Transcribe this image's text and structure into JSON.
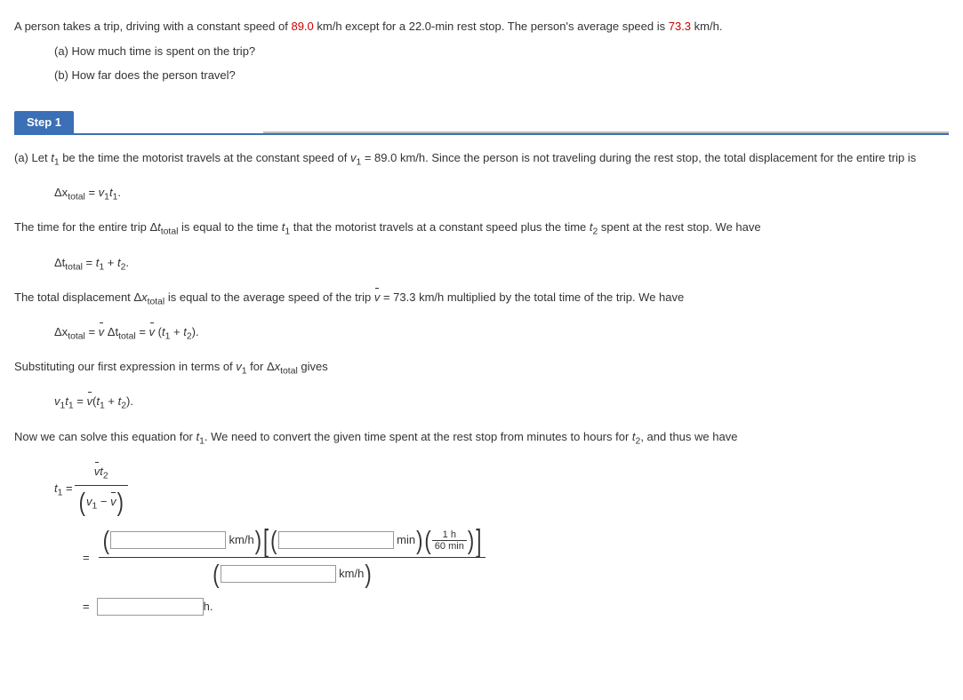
{
  "problem": {
    "intro_pre": "A person takes a trip, driving with a constant speed of ",
    "speed_const": "89.0",
    "intro_mid": " km/h except for a 22.0-min rest stop. The person's average speed is ",
    "speed_avg": "73.3",
    "intro_post": " km/h.",
    "qa": "(a) How much time is spent on the trip?",
    "qb": "(b) How far does the person travel?"
  },
  "step": {
    "label": "Step 1",
    "line_a_pre": "(a) Let ",
    "t1": "t",
    "t1_sub": "1",
    "line_a_mid": " be the time the motorist travels at the constant speed of ",
    "v1": "v",
    "v1_sub": "1",
    "line_a_val": " = 89.0 km/h. Since the person is not traveling during the rest stop, the total displacement for the entire trip is",
    "eq1_lhs": "Δx",
    "eq1_sub": "total",
    "eq1_eq": " = ",
    "eq1_rhs_v": "v",
    "eq1_rhs_vsub": "1",
    "eq1_rhs_t": "t",
    "eq1_rhs_tsub": "1",
    "eq1_end": ".",
    "line2_pre": "The time for the entire trip Δ",
    "line2_t": "t",
    "line2_tsub": "total",
    "line2_mid": " is equal to the time ",
    "line2_t1": "t",
    "line2_t1sub": "1",
    "line2_mid2": " that the motorist travels at a constant speed plus the time ",
    "line2_t2": "t",
    "line2_t2sub": "2",
    "line2_end": " spent at the rest stop. We have",
    "eq2_pre": "Δt",
    "eq2_sub": "total",
    "eq2_eq": " = ",
    "eq2_t1": "t",
    "eq2_t1sub": "1",
    "eq2_plus": " + ",
    "eq2_t2": "t",
    "eq2_t2sub": "2",
    "eq2_end": ".",
    "line3_pre": "The total displacement Δ",
    "line3_x": "x",
    "line3_xsub": "total",
    "line3_mid": " is equal to the average speed of the trip ",
    "line3_v": "v",
    "line3_val": " = 73.3 km/h multiplied by the total time of the trip. We have",
    "eq3_dx": "Δx",
    "eq3_dxsub": "total",
    "eq3_eq1": " = ",
    "eq3_v": "v",
    "eq3_dt": " Δt",
    "eq3_dtsub": "total",
    "eq3_eq2": " = ",
    "eq3_paren_open": " (",
    "eq3_t1": "t",
    "eq3_t1sub": "1",
    "eq3_plus": " + ",
    "eq3_t2": "t",
    "eq3_t2sub": "2",
    "eq3_paren_close": ").",
    "line4_pre": "Substituting our first expression in terms of ",
    "line4_v1": "v",
    "line4_v1sub": "1",
    "line4_mid": " for Δ",
    "line4_x": "x",
    "line4_xsub": "total",
    "line4_end": " gives",
    "eq4_v1": "v",
    "eq4_v1sub": "1",
    "eq4_t1": "t",
    "eq4_t1sub": "1",
    "eq4_eq": " = ",
    "eq4_v": "v",
    "eq4_popen": "(",
    "eq4_t1b": "t",
    "eq4_t1bsub": "1",
    "eq4_plus": " + ",
    "eq4_t2": "t",
    "eq4_t2sub": "2",
    "eq4_pclose": ").",
    "line5_pre": "Now we can solve this equation for ",
    "line5_t1": "t",
    "line5_t1sub": "1",
    "line5_mid": ". We need to convert the given time spent at the rest stop from minutes to hours for ",
    "line5_t2": "t",
    "line5_t2sub": "2",
    "line5_end": ", and thus we have",
    "frac1_lhs_t": "t",
    "frac1_lhs_tsub": "1",
    "frac1_eq": " = ",
    "frac1_num_v": "v",
    "frac1_num_t": "t",
    "frac1_num_tsub": "2",
    "frac1_den_v1": "v",
    "frac1_den_v1sub": "1",
    "frac1_den_minus": " − ",
    "frac1_den_v": "v",
    "units_kmh": " km/h",
    "units_min": " min",
    "units_1h": "1 h",
    "units_60min": "60 min",
    "eq_sign": "=",
    "units_h": " h."
  }
}
